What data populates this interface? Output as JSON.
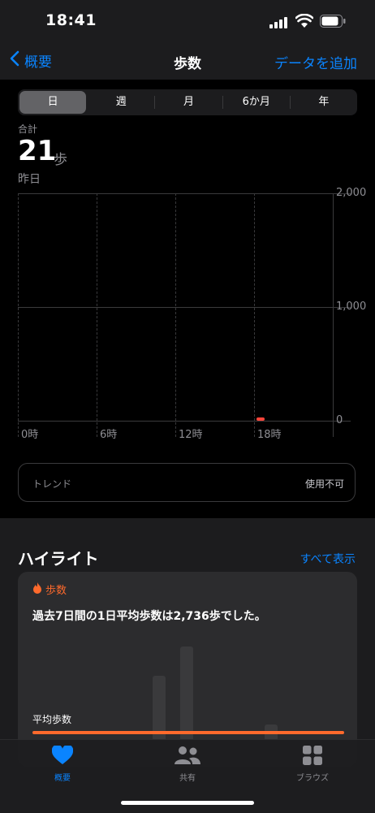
{
  "status_bar": {
    "time": "18:41"
  },
  "nav": {
    "back_label": "概要",
    "title": "歩数",
    "add_label": "データを追加"
  },
  "segments": [
    {
      "label": "日",
      "selected": true
    },
    {
      "label": "週",
      "selected": false
    },
    {
      "label": "月",
      "selected": false
    },
    {
      "label": "6か月",
      "selected": false
    },
    {
      "label": "年",
      "selected": false
    }
  ],
  "summary": {
    "label": "合計",
    "value": "21",
    "unit": "歩",
    "date": "昨日"
  },
  "chart_data": {
    "type": "bar",
    "x_ticks": [
      "0時",
      "6時",
      "12時",
      "18時"
    ],
    "y_ticks": [
      "2,000",
      "1,000",
      "0"
    ],
    "ylim": [
      0,
      2000
    ],
    "bars": [
      {
        "hour": 18,
        "value": 21
      }
    ],
    "bar_color": "#ff453a"
  },
  "trend": {
    "label": "トレンド",
    "value": "使用不可"
  },
  "highlights": {
    "title": "ハイライト",
    "show_all": "すべて表示",
    "card": {
      "category": "歩数",
      "message": "過去7日間の1日平均歩数は2,736歩でした。",
      "avg_label": "平均歩数",
      "accent": "#ff6a2c"
    }
  },
  "tabs": [
    {
      "label": "概要",
      "icon": "heart-icon",
      "active": true
    },
    {
      "label": "共有",
      "icon": "people-icon",
      "active": false
    },
    {
      "label": "ブラウズ",
      "icon": "grid-icon",
      "active": false
    }
  ]
}
